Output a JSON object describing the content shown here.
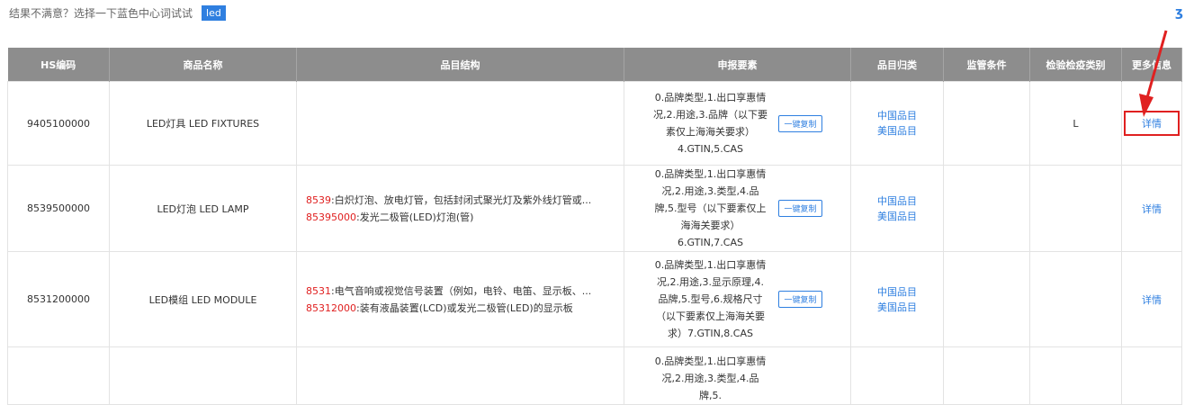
{
  "hint": {
    "text": "结果不满意？选择一下蓝色中心词试试",
    "tag": "led"
  },
  "corner_icon": "ʒ",
  "table": {
    "headers": [
      "HS编码",
      "商品名称",
      "品目结构",
      "申报要素",
      "品目归类",
      "监管条件",
      "检验检疫类别",
      "更多信息"
    ],
    "copy_label": "一键复制",
    "category_cn": "中国品目",
    "category_us": "美国品目",
    "detail_label": "详情",
    "rows": [
      {
        "hs": "9405100000",
        "name": "LED灯具 LED FIXTURES",
        "struct1_code": "",
        "struct1_text": "",
        "struct2_code": "",
        "struct2_text": "",
        "req": "0.品牌类型,1.出口享惠情况,2.用途,3.品牌（以下要素仅上海海关要求）4.GTIN,5.CAS",
        "supervision": "",
        "inspection": "L"
      },
      {
        "hs": "8539500000",
        "name": "LED灯泡 LED LAMP",
        "struct1_code": "8539",
        "struct1_text": ":白炽灯泡、放电灯管，包括封闭式聚光灯及紫外线灯管或...",
        "struct2_code": "85395000",
        "struct2_text": ":发光二极管(LED)灯泡(管)",
        "req": "0.品牌类型,1.出口享惠情况,2.用途,3.类型,4.品牌,5.型号（以下要素仅上海海关要求）6.GTIN,7.CAS",
        "supervision": "",
        "inspection": ""
      },
      {
        "hs": "8531200000",
        "name": "LED模组 LED MODULE",
        "struct1_code": "8531",
        "struct1_text": ":电气音响或视觉信号装置（例如，电铃、电笛、显示板、...",
        "struct2_code": "85312000",
        "struct2_text": ":装有液晶装置(LCD)或发光二极管(LED)的显示板",
        "req": "0.品牌类型,1.出口享惠情况,2.用途,3.显示原理,4.品牌,5.型号,6.规格尺寸（以下要素仅上海海关要求）7.GTIN,8.CAS",
        "supervision": "",
        "inspection": ""
      },
      {
        "hs": "",
        "name": "",
        "struct1_code": "",
        "struct1_text": "",
        "struct2_code": "",
        "struct2_text": "",
        "req": "0.品牌类型,1.出口享惠情况,2.用途,3.类型,4.品牌,5.",
        "supervision": "",
        "inspection": ""
      }
    ]
  }
}
